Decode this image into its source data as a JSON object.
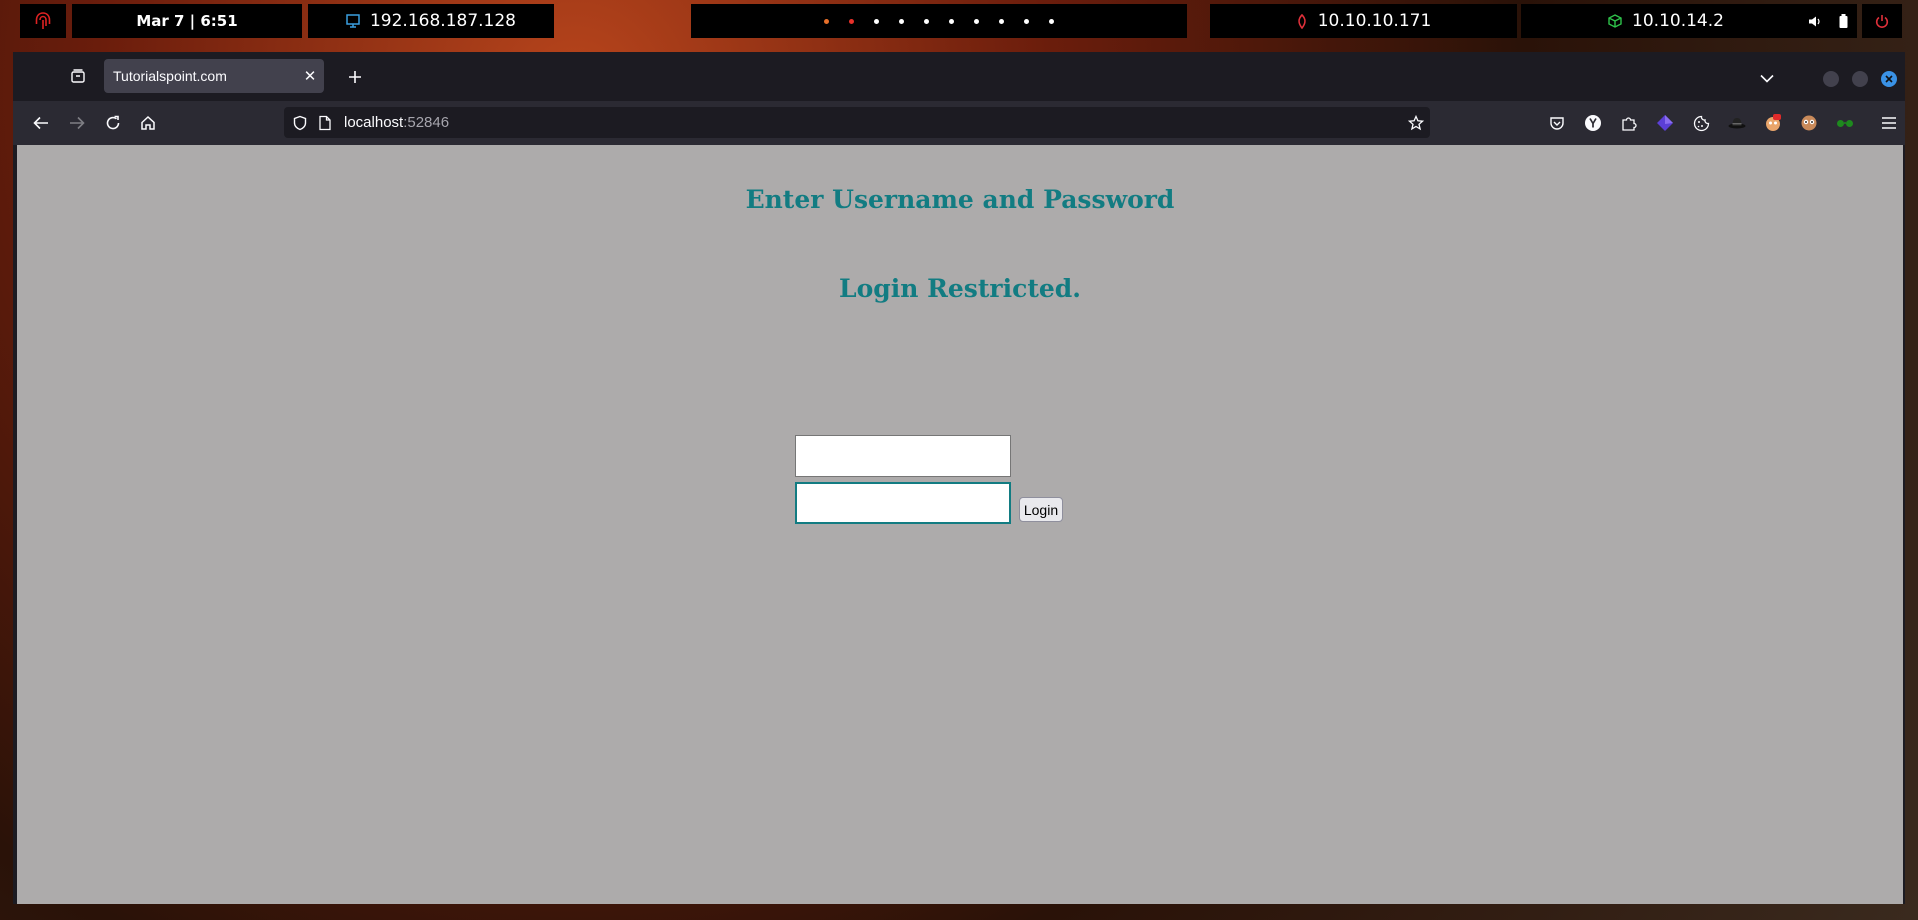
{
  "topbar": {
    "clock": "Mar 7 | 6:51",
    "vm_ip": "192.168.187.128",
    "target_ip": "10.10.10.171",
    "vpn_ip": "10.10.14.2",
    "workspace_count": 10,
    "active_workspace_colors": [
      "#e8702a",
      "#e8312a"
    ]
  },
  "browser": {
    "tab_title": "Tutorialspoint.com",
    "url_host": "localhost",
    "url_port": ":52846"
  },
  "page": {
    "heading": "Enter Username and Password",
    "status": "Login Restricted.",
    "username_value": "",
    "password_value": "",
    "login_label": "Login"
  },
  "colors": {
    "accent": "#127c82",
    "page_bg": "#adabab"
  }
}
